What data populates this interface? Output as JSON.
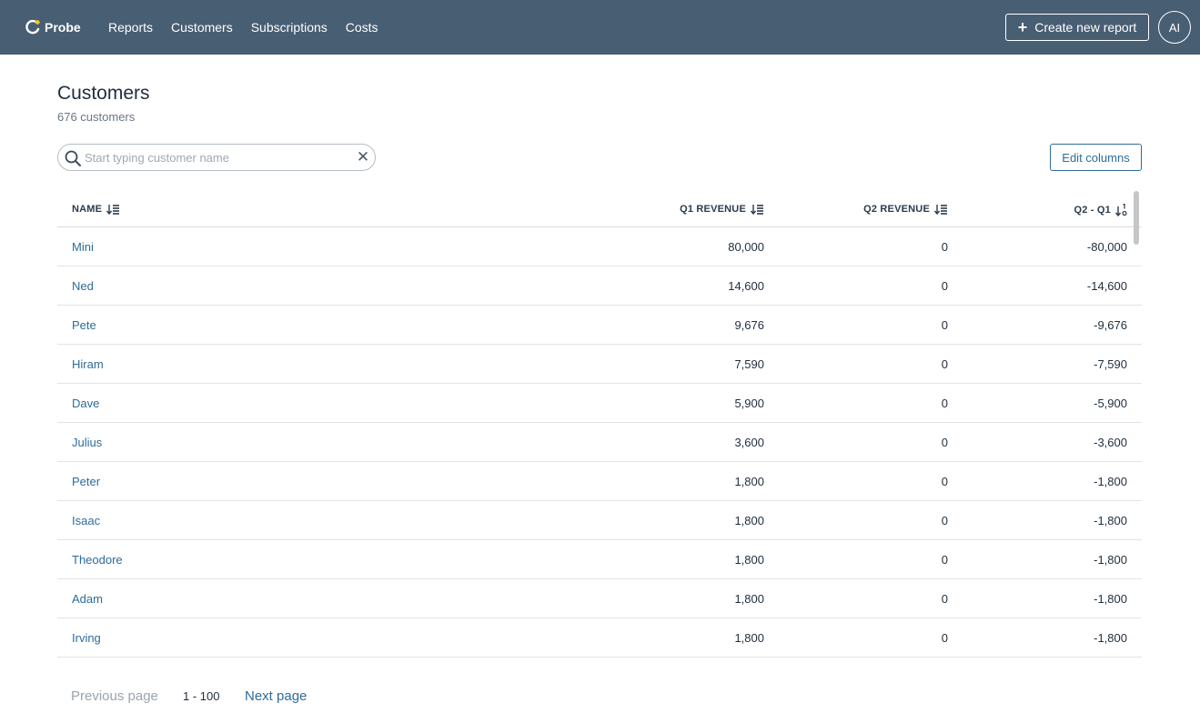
{
  "app": {
    "name": "Probe"
  },
  "nav": {
    "items": [
      "Reports",
      "Customers",
      "Subscriptions",
      "Costs"
    ]
  },
  "header": {
    "create_label": "Create new report",
    "avatar_initials": "AI"
  },
  "page": {
    "title": "Customers",
    "subtitle": "676 customers"
  },
  "search": {
    "placeholder": "Start typing customer name",
    "value": ""
  },
  "toolbar": {
    "edit_columns_label": "Edit columns"
  },
  "table": {
    "columns": [
      "NAME",
      "Q1 REVENUE",
      "Q2 REVENUE",
      "Q2 - Q1"
    ],
    "rows": [
      {
        "name": "Mini",
        "q1": "80,000",
        "q2": "0",
        "diff": "-80,000"
      },
      {
        "name": "Ned",
        "q1": "14,600",
        "q2": "0",
        "diff": "-14,600"
      },
      {
        "name": "Pete",
        "q1": "9,676",
        "q2": "0",
        "diff": "-9,676"
      },
      {
        "name": "Hiram",
        "q1": "7,590",
        "q2": "0",
        "diff": "-7,590"
      },
      {
        "name": "Dave",
        "q1": "5,900",
        "q2": "0",
        "diff": "-5,900"
      },
      {
        "name": "Julius",
        "q1": "3,600",
        "q2": "0",
        "diff": "-3,600"
      },
      {
        "name": "Peter",
        "q1": "1,800",
        "q2": "0",
        "diff": "-1,800"
      },
      {
        "name": "Isaac",
        "q1": "1,800",
        "q2": "0",
        "diff": "-1,800"
      },
      {
        "name": "Theodore",
        "q1": "1,800",
        "q2": "0",
        "diff": "-1,800"
      },
      {
        "name": "Adam",
        "q1": "1,800",
        "q2": "0",
        "diff": "-1,800"
      },
      {
        "name": "Irving",
        "q1": "1,800",
        "q2": "0",
        "diff": "-1,800"
      }
    ]
  },
  "pagination": {
    "prev_label": "Previous page",
    "range": "1 - 100",
    "next_label": "Next page"
  },
  "colors": {
    "topbar": "#485e73",
    "link": "#2e6c99",
    "logo_accent": "#f5c518"
  },
  "icons": {
    "logo": "probe-logo-icon",
    "plus": "plus-icon",
    "search": "search-icon",
    "clear": "close-icon",
    "sort_desc": "sort-descending-icon",
    "sort_numeric": "sort-numeric-icon"
  }
}
